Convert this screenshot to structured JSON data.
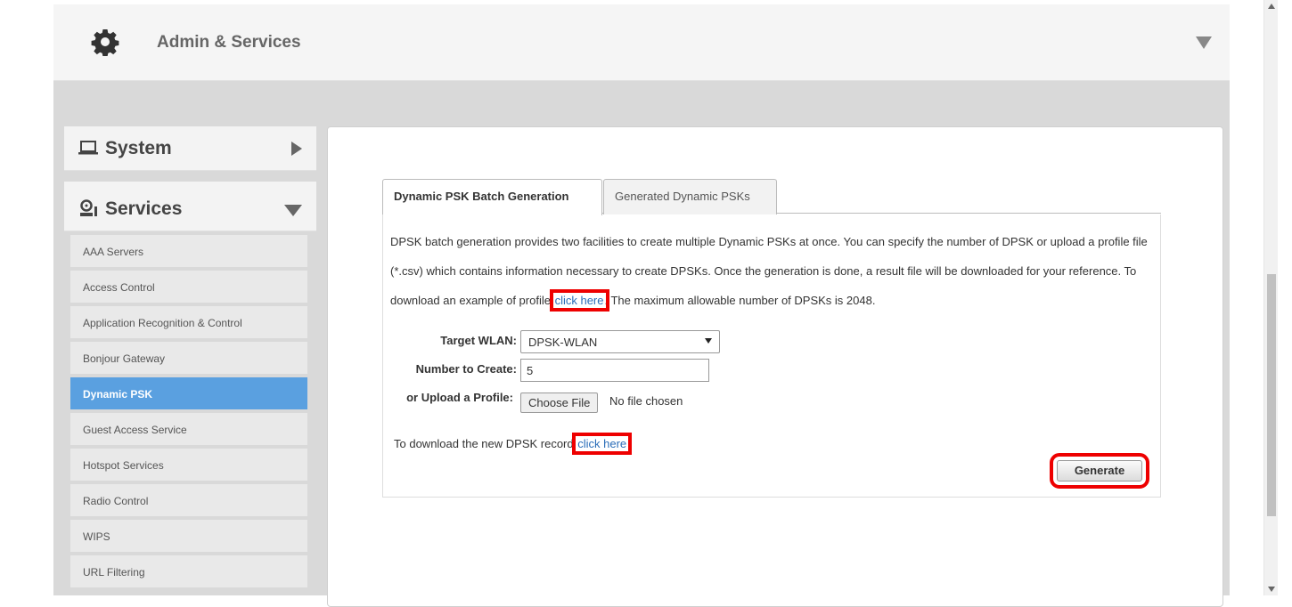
{
  "header": {
    "title": "Admin & Services"
  },
  "sidebar": {
    "system_label": "System",
    "services_label": "Services",
    "items": [
      {
        "label": "AAA Servers"
      },
      {
        "label": "Access Control"
      },
      {
        "label": "Application Recognition & Control"
      },
      {
        "label": "Bonjour Gateway"
      },
      {
        "label": "Dynamic PSK",
        "active": true
      },
      {
        "label": "Guest Access Service"
      },
      {
        "label": "Hotspot Services"
      },
      {
        "label": "Radio Control"
      },
      {
        "label": "WIPS"
      },
      {
        "label": "URL Filtering"
      }
    ]
  },
  "tabs": [
    {
      "label": "Dynamic PSK Batch Generation",
      "active": true
    },
    {
      "label": "Generated Dynamic PSKs",
      "active": false
    }
  ],
  "description": {
    "part1": "DPSK batch generation provides two facilities to create multiple Dynamic PSKs at once. You can specify the number of DPSK or upload a profile file (*.csv) which contains information necessary to create DPSKs. Once the generation is done, a result file will be downloaded for your reference. To download an example of profile",
    "link": "click here",
    "part2": ". The maximum allowable number of DPSKs is 2048."
  },
  "form": {
    "target_wlan_label": "Target WLAN:",
    "target_wlan_value": "DPSK-WLAN",
    "number_label": "Number to Create:",
    "number_value": "5",
    "upload_label": "or Upload a Profile:",
    "choose_file": "Choose File",
    "no_file": "No file chosen",
    "download_text": "To download the new DPSK record",
    "download_link": "click here",
    "generate": "Generate"
  },
  "colors": {
    "active_item": "#5aa0e0",
    "link": "#2a6db8",
    "highlight": "#e00000"
  }
}
